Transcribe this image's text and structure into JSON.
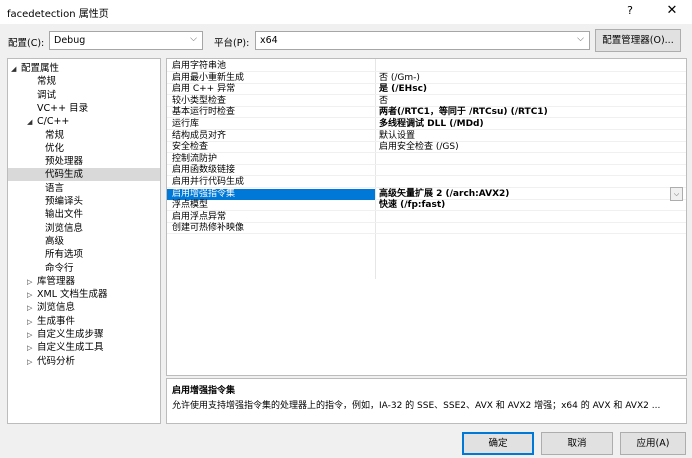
{
  "window": {
    "title": "facedetection 属性页",
    "help": "?",
    "close": "✕"
  },
  "config": {
    "label": "配置(C):",
    "value": "Debug",
    "platform_label": "平台(P):",
    "platform_value": "x64",
    "manager_button": "配置管理器(O)..."
  },
  "tree": [
    {
      "label": "配置属性",
      "exp": "◢",
      "level": 0,
      "selected": false
    },
    {
      "label": "常规",
      "exp": "",
      "level": 1,
      "selected": false
    },
    {
      "label": "调试",
      "exp": "",
      "level": 1,
      "selected": false
    },
    {
      "label": "VC++ 目录",
      "exp": "",
      "level": 1,
      "selected": false
    },
    {
      "label": "C/C++",
      "exp": "◢",
      "level": 1,
      "selected": false
    },
    {
      "label": "常规",
      "exp": "",
      "level": 2,
      "selected": false
    },
    {
      "label": "优化",
      "exp": "",
      "level": 2,
      "selected": false
    },
    {
      "label": "预处理器",
      "exp": "",
      "level": 2,
      "selected": false
    },
    {
      "label": "代码生成",
      "exp": "",
      "level": 2,
      "selected": true
    },
    {
      "label": "语言",
      "exp": "",
      "level": 2,
      "selected": false
    },
    {
      "label": "预编译头",
      "exp": "",
      "level": 2,
      "selected": false
    },
    {
      "label": "输出文件",
      "exp": "",
      "level": 2,
      "selected": false
    },
    {
      "label": "浏览信息",
      "exp": "",
      "level": 2,
      "selected": false
    },
    {
      "label": "高级",
      "exp": "",
      "level": 2,
      "selected": false
    },
    {
      "label": "所有选项",
      "exp": "",
      "level": 2,
      "selected": false
    },
    {
      "label": "命令行",
      "exp": "",
      "level": 2,
      "selected": false
    },
    {
      "label": "库管理器",
      "exp": "▷",
      "level": 1,
      "selected": false
    },
    {
      "label": "XML 文档生成器",
      "exp": "▷",
      "level": 1,
      "selected": false
    },
    {
      "label": "浏览信息",
      "exp": "▷",
      "level": 1,
      "selected": false
    },
    {
      "label": "生成事件",
      "exp": "▷",
      "level": 1,
      "selected": false
    },
    {
      "label": "自定义生成步骤",
      "exp": "▷",
      "level": 1,
      "selected": false
    },
    {
      "label": "自定义生成工具",
      "exp": "▷",
      "level": 1,
      "selected": false
    },
    {
      "label": "代码分析",
      "exp": "▷",
      "level": 1,
      "selected": false
    }
  ],
  "properties": [
    {
      "name": "启用字符串池",
      "value": "",
      "bold": false,
      "selected": false
    },
    {
      "name": "启用最小重新生成",
      "value": "否 (/Gm-)",
      "bold": false,
      "selected": false
    },
    {
      "name": "启用 C++ 异常",
      "value": "是 (/EHsc)",
      "bold": true,
      "selected": false
    },
    {
      "name": "较小类型检查",
      "value": "否",
      "bold": false,
      "selected": false
    },
    {
      "name": "基本运行时检查",
      "value": "两者(/RTC1，等同于 /RTCsu) (/RTC1)",
      "bold": true,
      "selected": false
    },
    {
      "name": "运行库",
      "value": "多线程调试 DLL (/MDd)",
      "bold": true,
      "selected": false
    },
    {
      "name": "结构成员对齐",
      "value": "默认设置",
      "bold": false,
      "selected": false
    },
    {
      "name": "安全检查",
      "value": "启用安全检查 (/GS)",
      "bold": false,
      "selected": false
    },
    {
      "name": "控制流防护",
      "value": "",
      "bold": false,
      "selected": false
    },
    {
      "name": "启用函数级链接",
      "value": "",
      "bold": false,
      "selected": false
    },
    {
      "name": "启用并行代码生成",
      "value": "",
      "bold": false,
      "selected": false
    },
    {
      "name": "启用增强指令集",
      "value": "高级矢量扩展 2 (/arch:AVX2)",
      "bold": true,
      "selected": true
    },
    {
      "name": "浮点模型",
      "value": "快速 (/fp:fast)",
      "bold": true,
      "selected": false
    },
    {
      "name": "启用浮点异常",
      "value": "",
      "bold": false,
      "selected": false
    },
    {
      "name": "创建可热修补映像",
      "value": "",
      "bold": false,
      "selected": false
    }
  ],
  "description": {
    "title": "启用增强指令集",
    "text": "允许使用支持增强指令集的处理器上的指令，例如，IA-32 的 SSE、SSE2、AVX 和 AVX2 增强；x64 的 AVX 和 AVX2 ..."
  },
  "buttons": {
    "ok": "确定",
    "cancel": "取消",
    "apply": "应用(A)"
  },
  "colors": {
    "selection": "#0078d7",
    "tree_selection": "#d9d9d9"
  }
}
